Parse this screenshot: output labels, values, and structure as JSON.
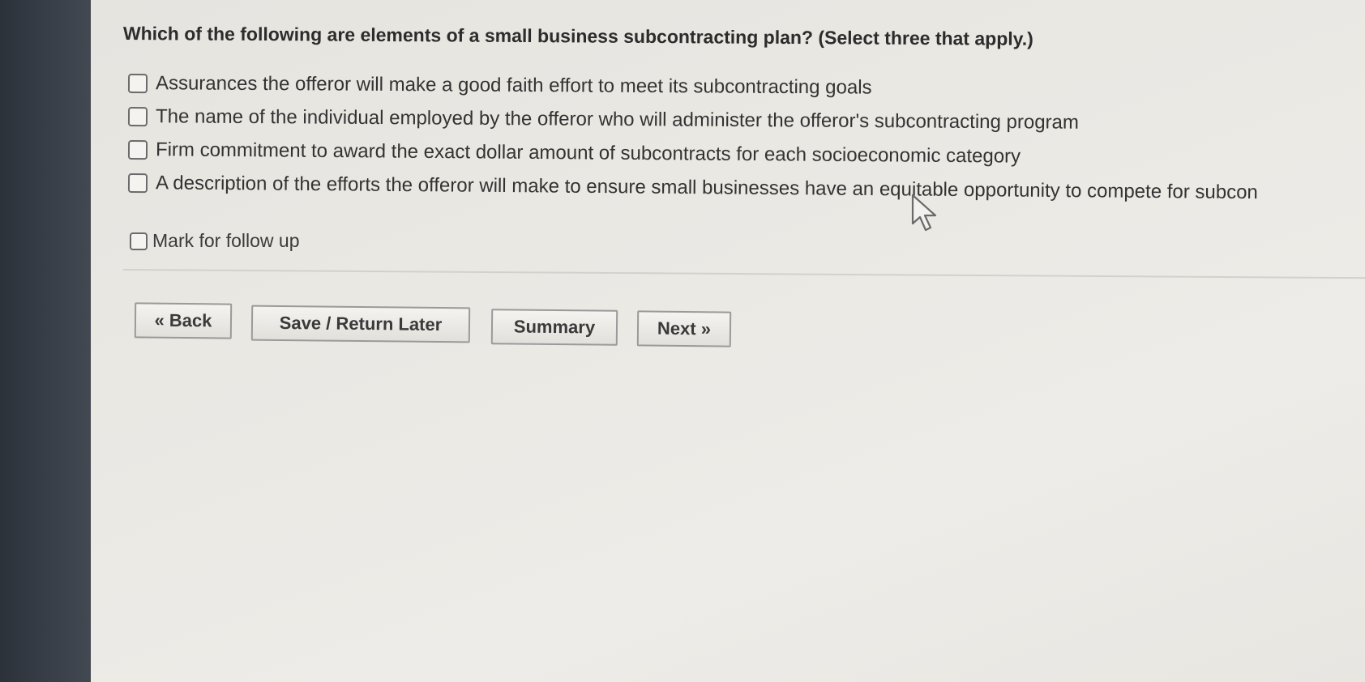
{
  "question": {
    "text": "Which of the following are elements of a small business subcontracting plan? (Select three that apply.)"
  },
  "options": [
    {
      "label": "Assurances the offeror will make a good faith effort to meet its subcontracting goals",
      "checked": false
    },
    {
      "label": "The name of the individual employed by the offeror who will administer the offeror's subcontracting program",
      "checked": false
    },
    {
      "label": "Firm commitment to award the exact dollar amount of subcontracts for each socioeconomic category",
      "checked": false
    },
    {
      "label": "A description of the efforts the offeror will make to ensure small businesses have an equitable opportunity to compete for subcon",
      "checked": false
    }
  ],
  "mark_follow_up": {
    "label": "Mark for follow up",
    "checked": false
  },
  "buttons": {
    "back": "« Back",
    "save": "Save / Return Later",
    "summary": "Summary",
    "next": "Next »"
  },
  "icons": {
    "cursor": "mouse-pointer-icon"
  }
}
